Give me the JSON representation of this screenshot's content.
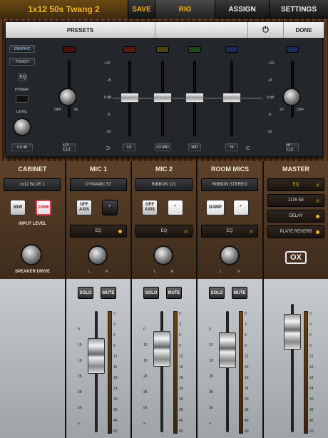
{
  "topbar": {
    "preset": "1x12 50s Twang 2",
    "save": "SAVE",
    "rig": "RIG",
    "assign": "ASSIGN",
    "settings": "SETTINGS"
  },
  "eq": {
    "presets": "PRESETS",
    "power_icon": "power-icon",
    "done": "DONE",
    "graphic": "GRAPHIC",
    "touch": "TOUCH",
    "eq": "EQ",
    "power": "POWER",
    "level": "LEVEL",
    "level_value": "0.0 dB",
    "locut": "LO CUT",
    "hicut": "HI CUT",
    "off": "OFF",
    "5k": "5k",
    "20": "20",
    "off2": "OFF",
    "bands": [
      "LO",
      "LO MID",
      "MID",
      "HI"
    ],
    "scale": [
      "+10",
      "+5",
      "0 dB",
      "-5",
      "-10"
    ]
  },
  "cabinet": {
    "title": "CABINET",
    "model": "1x12 BLUE J",
    "b50": "50W",
    "b100": "100W",
    "input_level": "INPUT LEVEL",
    "drive": "SPEAKER DRIVE"
  },
  "mic1": {
    "title": "MIC 1",
    "model": "DYNAMIC 57",
    "offaxis": "OFF AXIS",
    "eq": "EQ"
  },
  "mic2": {
    "title": "MIC 2",
    "model": "RIBBON 121",
    "offaxis": "OFF AXIS",
    "eq": "EQ"
  },
  "room": {
    "title": "ROOM MICS",
    "model": "RIBBON STEREO",
    "damp": "DAMP",
    "eq": "EQ"
  },
  "master": {
    "title": "MASTER",
    "fx": [
      "EQ",
      "1176 SE",
      "DELAY",
      "PLATE REVERB"
    ],
    "logo": "OX"
  },
  "channel": {
    "solo": "SOLO",
    "mute": "MUTE",
    "l": "L",
    "r": "R"
  },
  "meter_scale": [
    "0",
    "3",
    "6",
    "9",
    "12",
    "15",
    "18",
    "24",
    "30",
    "36",
    "46",
    "60"
  ],
  "fader_scale": [
    "0",
    "10",
    "18",
    "28",
    "38",
    "56",
    "∞"
  ]
}
